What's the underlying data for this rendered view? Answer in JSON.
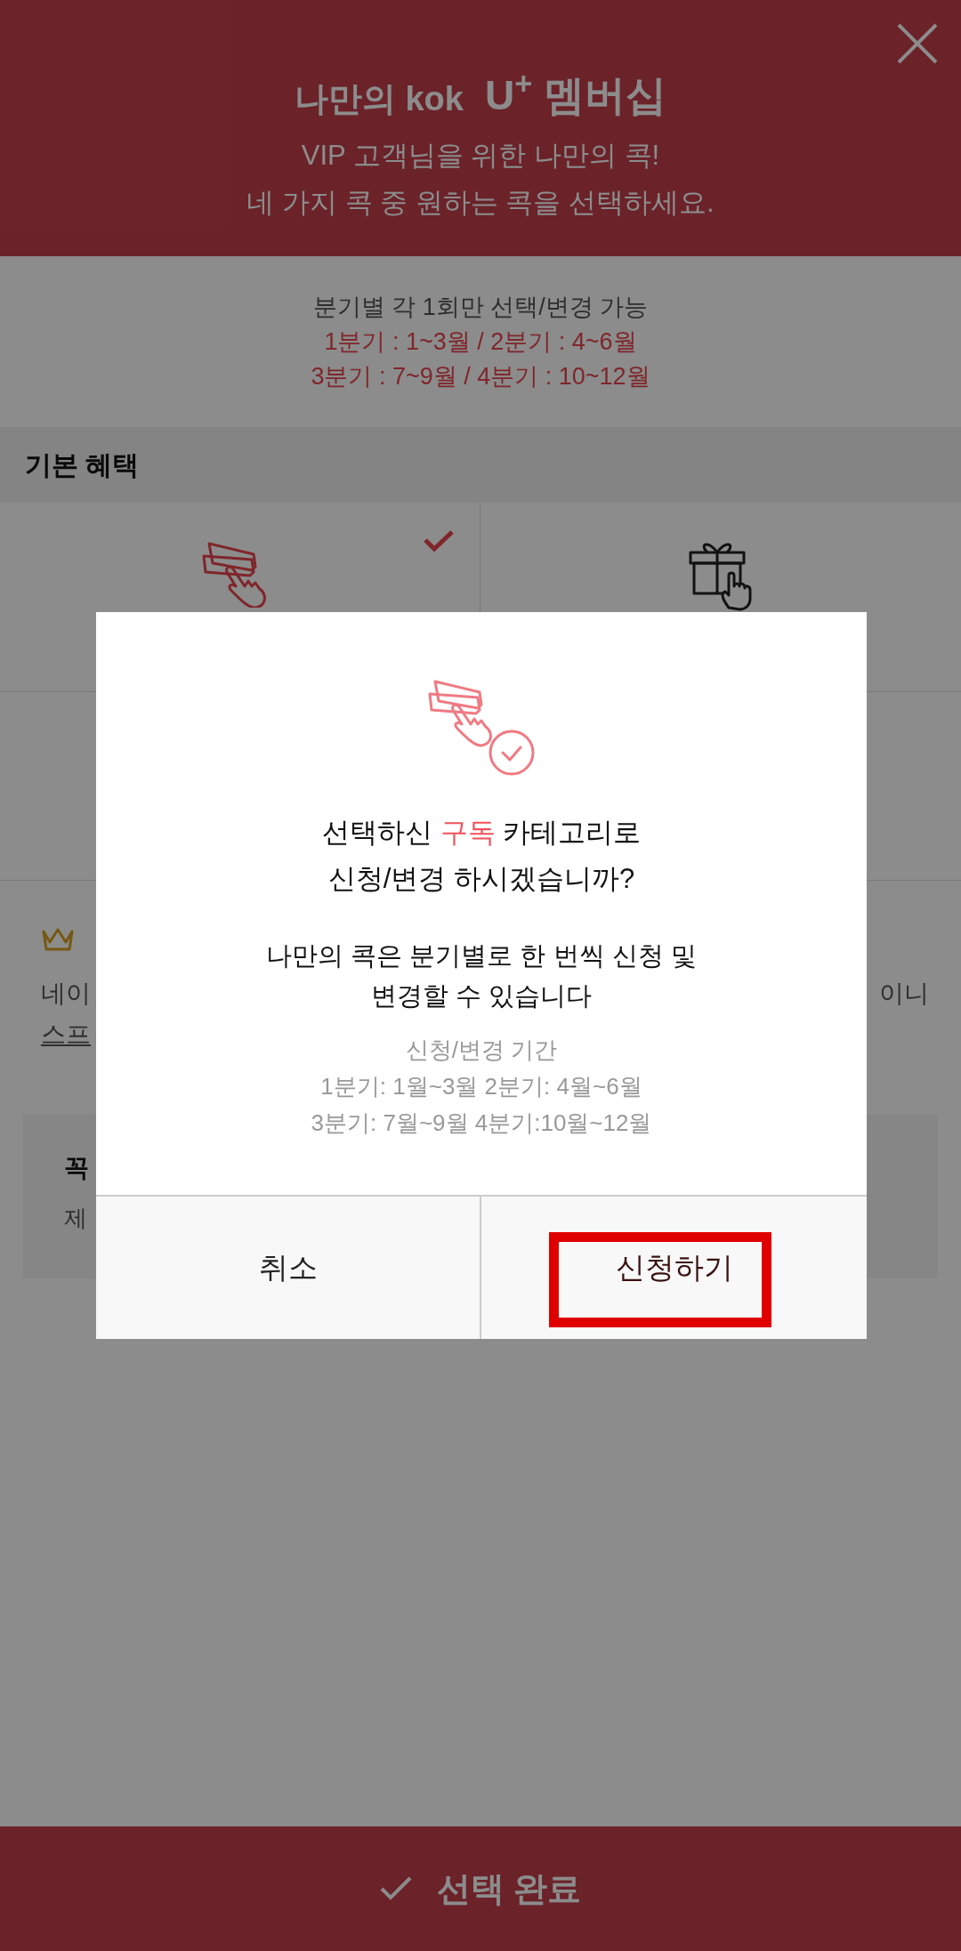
{
  "header": {
    "logo_left": "나만의 kok",
    "logo_right": "U$^{+}$ 멤버십",
    "lines": [
      "VIP 고객님을 위한 나만의 콕!",
      "네 가지 콕 중 원하는 콕을 선택하세요."
    ]
  },
  "notice": {
    "lines": [
      {
        "text": "분기별 각 1회만 선택/변경 가능",
        "kind": "plain"
      },
      {
        "text": "1분기 : 1~3월 / 2분기 : 4~6월",
        "kind": "accent"
      },
      {
        "text": "3분기 : 7~9월 / 4분기 : 10~12월",
        "kind": "accent"
      }
    ]
  },
  "section_title": "기본 혜택",
  "benefits": [
    {
      "kind": "ticket",
      "selected": true
    },
    {
      "kind": "gift",
      "selected": false
    }
  ],
  "vip": {
    "left_lines": [
      "네이",
      "스프"
    ],
    "right_line": "이니"
  },
  "info_box": {
    "title": "꼭",
    "text": "제"
  },
  "dialog": {
    "question": {
      "prefix": "선택하신 ",
      "category": "구독",
      "suffix": " 카테고리로",
      "line2": "신청/변경 하시겠습니까?"
    },
    "body_lines": [
      "나만의 콕은 분기별로 한 번씩 신청 및",
      "변경할 수 있습니다"
    ],
    "period_lines": [
      "신청/변경 기간",
      "1분기: 1월~3월 2분기: 4월~6월",
      "3분기: 7월~9월 4분기:10월~12월"
    ],
    "buttons": [
      {
        "label": "취소",
        "kind": "cancel",
        "highlighted": false
      },
      {
        "label": "신청하기",
        "kind": "confirm",
        "highlighted": true
      }
    ]
  },
  "bottom_button": "선택 완료"
}
